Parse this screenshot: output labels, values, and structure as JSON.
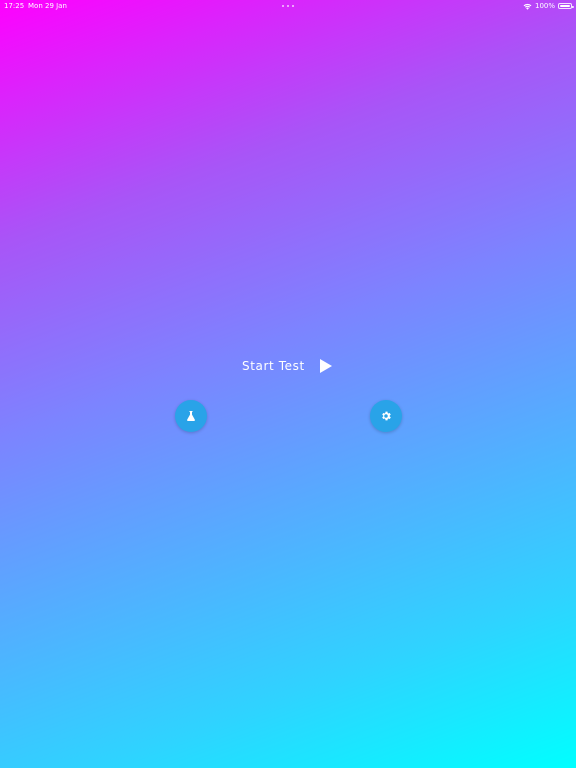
{
  "status_bar": {
    "time": "17:25",
    "date": "Mon 29 Jan",
    "battery": "100%"
  },
  "main": {
    "start_label": "Start Test"
  },
  "icons": {
    "wifi": "wifi-icon",
    "battery": "battery-icon",
    "play": "play-icon",
    "flask": "flask-icon",
    "gear": "gear-icon"
  },
  "colors": {
    "gradient_start": "#ff00ff",
    "gradient_end": "#00ffff",
    "button_bg": "#29a3e8",
    "text": "#ffffff"
  }
}
